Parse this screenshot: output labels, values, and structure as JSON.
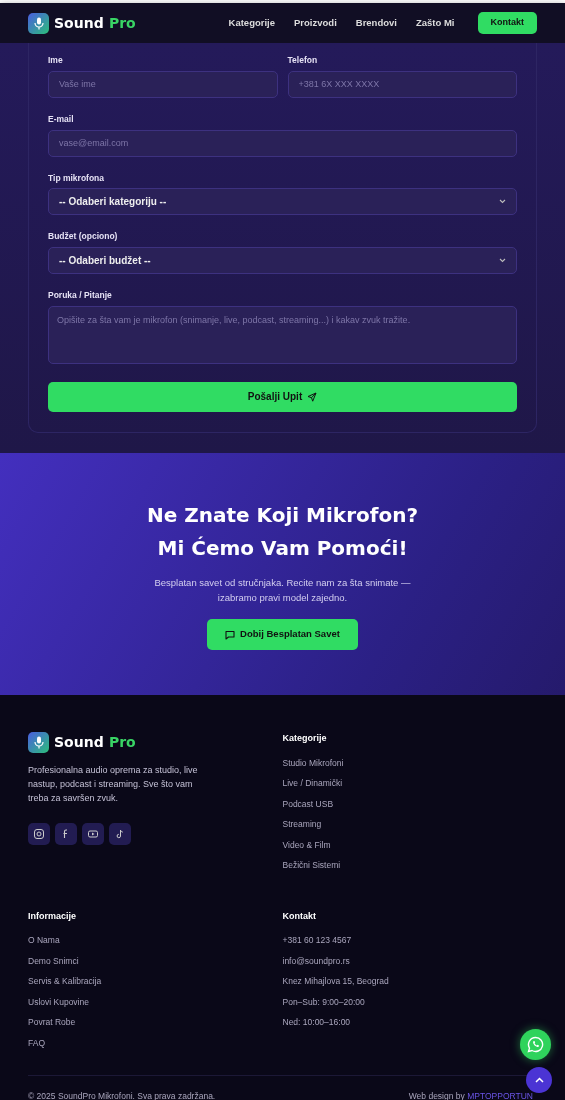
{
  "navbar": {
    "brand": {
      "first": "Sound",
      "second": "Pro"
    },
    "links": [
      "Kategorije",
      "Proizvodi",
      "Brendovi",
      "Zašto Mi"
    ],
    "cta": "Kontakt"
  },
  "form": {
    "rows": [
      [
        {
          "kind": "input",
          "label": "Ime",
          "placeholder": "Vaše ime"
        },
        {
          "kind": "input",
          "label": "Telefon",
          "placeholder": "+381 6X XXX XXXX"
        }
      ],
      [
        {
          "kind": "input",
          "label": "E-mail",
          "placeholder": "vase@email.com"
        }
      ],
      [
        {
          "kind": "select",
          "label": "Tip mikrofona",
          "value": "-- Odaberi kategoriju --"
        }
      ],
      [
        {
          "kind": "select",
          "label": "Budžet (opciono)",
          "value": "-- Odaberi budžet --"
        }
      ],
      [
        {
          "kind": "textarea",
          "label": "Poruka / Pitanje",
          "placeholder": "Opišite za šta vam je mikrofon (snimanje, live, podcast, streaming...) i kakav zvuk tražite."
        }
      ]
    ],
    "submit": "Pošalji Upit"
  },
  "cta": {
    "title": [
      "Ne Znate Koji Mikrofon?",
      "Mi Ćemo Vam Pomoći!"
    ],
    "text": "Besplatan savet od stručnjaka. Recite nam za šta snimate — izabramo pravi model zajedno.",
    "button": "Dobij Besplatan Savet"
  },
  "footer": {
    "brand": {
      "first": "Sound",
      "second": "Pro"
    },
    "description": "Profesionalna audio oprema za studio, live nastup, podcast i streaming. Sve što vam treba za savršen zvuk.",
    "socials": [
      {
        "kind": "instagram"
      },
      {
        "kind": "facebook"
      },
      {
        "kind": "youtube"
      },
      {
        "kind": "tiktok"
      }
    ],
    "columns": [
      {
        "title": "Kategorije",
        "links": [
          "Studio Mikrofoni",
          "Live / Dinamički",
          "Podcast USB",
          "Streaming",
          "Video & Film",
          "Bežični Sistemi"
        ]
      },
      {
        "title": "Informacije",
        "links": [
          "O Nama",
          "Demo Snimci",
          "Servis & Kalibracija",
          "Uslovi Kupovine",
          "Povrat Robe",
          "FAQ"
        ]
      },
      {
        "title": "Kontakt",
        "links": [
          "+381 60 123 4567",
          "info@soundpro.rs",
          "Knez Mihajlova 15, Beograd",
          "Pon–Sub: 9:00–20:00",
          "Ned: 10:00–16:00"
        ]
      }
    ],
    "copyright": "© 2025 SoundPro Mikrofoni. Sva prava zadržana.",
    "credit": {
      "text": "Web design by",
      "link": "MPTOPPORTUN"
    }
  }
}
